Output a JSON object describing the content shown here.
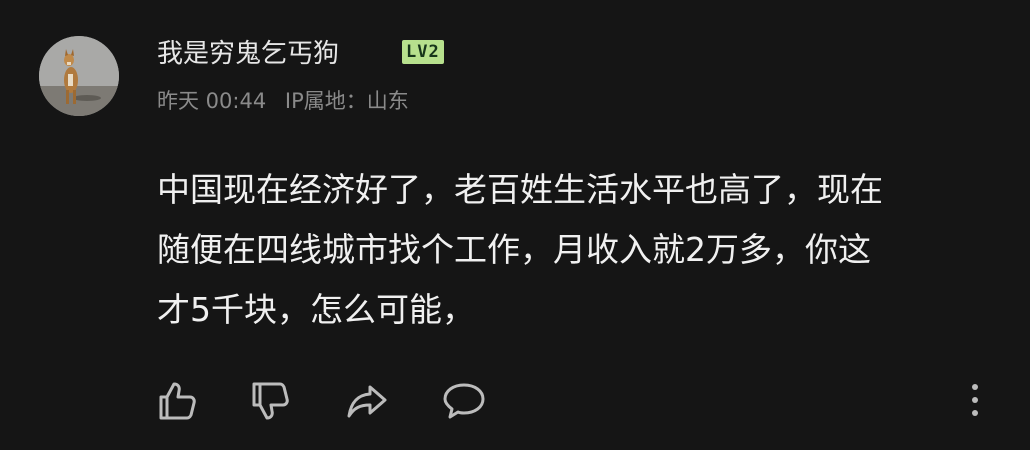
{
  "comment": {
    "username": "我是穷鬼乞丐狗",
    "level": "LV2",
    "time": "昨天 00:44",
    "ip_location": "IP属地：山东",
    "text_lines": [
      "中国现在经济好了，老百姓生活水平也高了，现在",
      "随便在四线城市找个工作，月收入就2万多，你这",
      "才5千块，怎么可能，"
    ]
  },
  "actions": {
    "icons": [
      "thumbs-up-icon",
      "thumbs-down-icon",
      "share-icon",
      "reply-icon",
      "more-vertical-icon"
    ]
  },
  "colors": {
    "background": "#151515",
    "text": "#f0f0f0",
    "meta": "#8a8a8a",
    "badge": "#b7e08d"
  }
}
